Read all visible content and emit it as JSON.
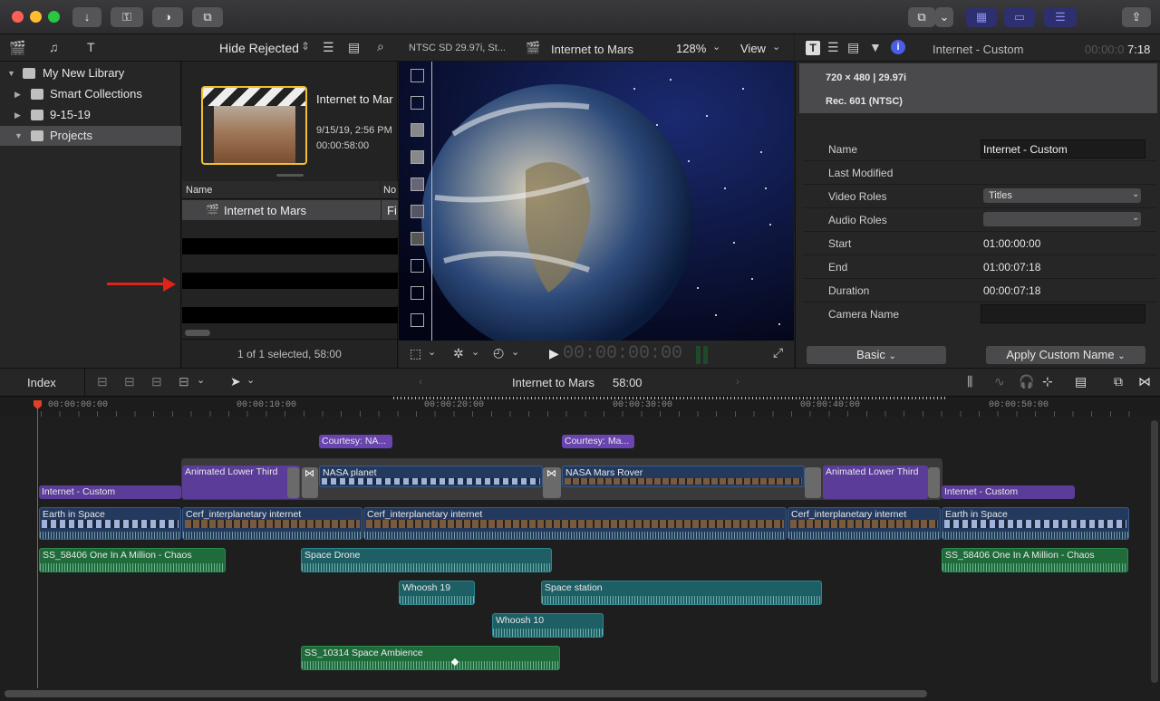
{
  "browser": {
    "filter_label": "Hide Rejected",
    "library": [
      {
        "label": "My New Library"
      },
      {
        "label": "Smart Collections"
      },
      {
        "label": "9-15-19"
      },
      {
        "label": "Projects"
      }
    ],
    "project": {
      "title": "Internet to Mar",
      "date": "9/15/19, 2:56 PM",
      "duration": "00:00:58:00"
    },
    "columns": [
      "Name",
      "No"
    ],
    "row_name": "Internet to Mars",
    "row_extra": "Fi",
    "status": "1 of 1 selected, 58:00"
  },
  "viewer": {
    "format": "NTSC SD 29.97i, St...",
    "title": "Internet to Mars",
    "zoom": "128%",
    "view_label": "View",
    "timecode": "00:00:00:00"
  },
  "inspector": {
    "title": "Internet - Custom",
    "timecode_dim": "00:00:0",
    "timecode_bright": "7:18",
    "resolution": "720 × 480 | 29.97i",
    "colorspace": "Rec. 601 (NTSC)",
    "rows": [
      {
        "label": "Name",
        "value": "Internet - Custom"
      },
      {
        "label": "Last Modified",
        "value": ""
      },
      {
        "label": "Video Roles",
        "value": "Titles"
      },
      {
        "label": "Audio Roles",
        "value": ""
      },
      {
        "label": "Start",
        "value": "01:00:00:00"
      },
      {
        "label": "End",
        "value": "01:00:07:18"
      },
      {
        "label": "Duration",
        "value": "00:00:07:18"
      },
      {
        "label": "Camera Name",
        "value": ""
      }
    ],
    "basic_label": "Basic",
    "apply_label": "Apply Custom Name"
  },
  "timeline": {
    "index_label": "Index",
    "project_name": "Internet to Mars",
    "project_duration": "58:00",
    "ticks": [
      "00:00:00:00",
      "00:00:10:00",
      "00:00:20:00",
      "00:00:30:00",
      "00:00:40:00",
      "00:00:50:00"
    ],
    "clips": {
      "courtesy_nasa": "Courtesy: NA...",
      "courtesy_mars": "Courtesy: Ma...",
      "lower_third_1": "Animated Lower Third",
      "nasa_planet": "NASA planet",
      "mars_rover": "NASA Mars Rover",
      "lower_third_2": "Animated Lower Third",
      "title_left": "Internet - Custom",
      "title_right": "Internet - Custom",
      "earth_left": "Earth in Space",
      "cerf_1": "Cerf_interplanetary internet",
      "cerf_2": "Cerf_interplanetary internet",
      "cerf_3": "Cerf_interplanetary internet",
      "earth_right": "Earth in Space",
      "chaos_left": "SS_58406 One In A Million - Chaos",
      "space_drone": "Space Drone",
      "chaos_right": "SS_58406 One In A Million - Chaos",
      "whoosh_19": "Whoosh 19",
      "space_station": "Space station",
      "whoosh_10": "Whoosh 10",
      "ambience": "SS_10314 Space Ambience"
    }
  },
  "colors": {
    "accent_yellow": "#f0c030",
    "title_purple": "#5b3c99",
    "video_blue": "#233a5e",
    "audio_teal": "#1e5f66",
    "music_green": "#1f6b3a",
    "playhead": "#e0402a"
  }
}
